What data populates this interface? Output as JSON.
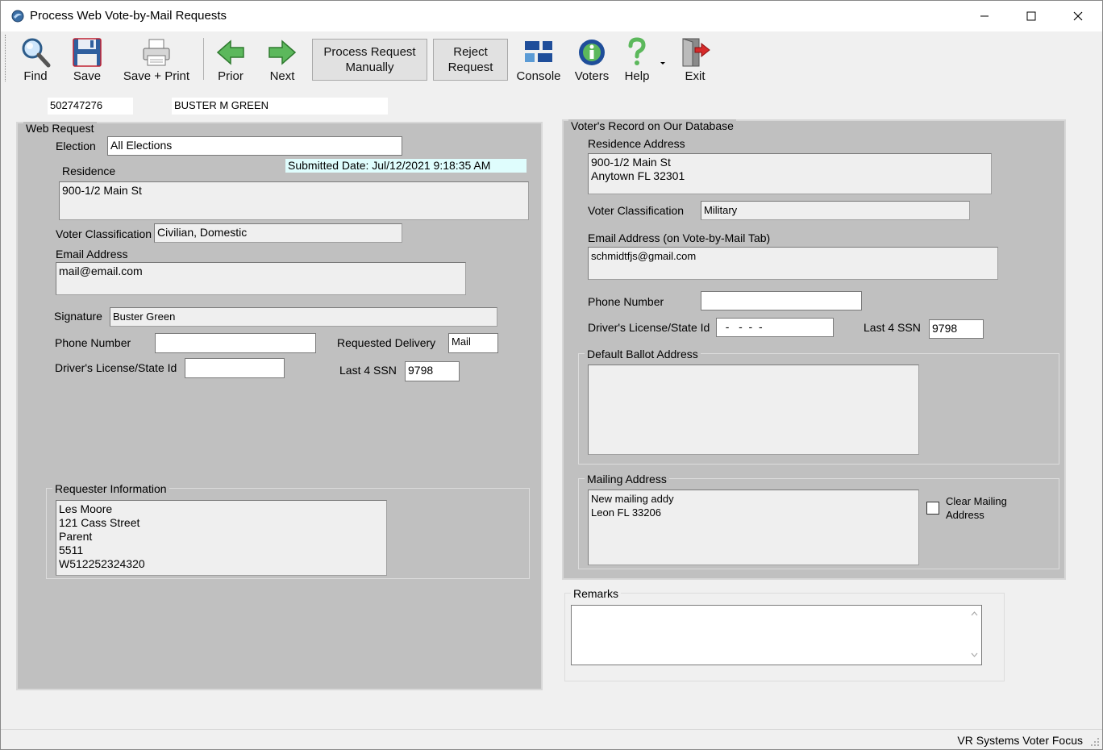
{
  "window": {
    "title": "Process Web Vote-by-Mail Requests"
  },
  "toolbar": {
    "find": "Find",
    "save": "Save",
    "save_print": "Save + Print",
    "prior": "Prior",
    "next": "Next",
    "process_manually_1": "Process Request",
    "process_manually_2": "Manually",
    "reject_1": "Reject",
    "reject_2": "Request",
    "console": "Console",
    "voters": "Voters",
    "help": "Help",
    "exit": "Exit"
  },
  "header": {
    "voter_id": "502747276",
    "voter_name": "BUSTER M GREEN"
  },
  "web_request": {
    "legend": "Web Request",
    "election_label": "Election",
    "election_value": "All Elections",
    "submitted_date": "Submitted Date: Jul/12/2021 9:18:35 AM",
    "residence_label": "Residence",
    "residence_value": "900-1/2 Main St",
    "voter_class_label": "Voter Classification",
    "voter_class_value": "Civilian, Domestic",
    "email_label": "Email Address",
    "email_value": "mail@email.com",
    "signature_label": "Signature",
    "signature_value": "Buster Green",
    "phone_label": "Phone Number",
    "phone_value": "",
    "requested_delivery_label": "Requested Delivery",
    "requested_delivery_value": "Mail",
    "dl_label": "Driver's License/State Id",
    "dl_value": "",
    "ssn_label": "Last 4 SSN",
    "ssn_value": "9798",
    "requester_legend": "Requester Information",
    "requester_lines": [
      "Les Moore",
      "121 Cass Street",
      "Parent",
      "5511",
      "W512252324320"
    ]
  },
  "voter_record": {
    "legend": "Voter's Record on Our Database",
    "residence_label": "Residence Address",
    "residence_lines": [
      "900-1/2 Main St",
      "Anytown FL 32301"
    ],
    "voter_class_label": "Voter Classification",
    "voter_class_value": "Military",
    "email_label": "Email Address (on Vote-by-Mail Tab)",
    "email_value": "schmidtfjs@gmail.com",
    "phone_label": "Phone Number",
    "phone_value": "",
    "dl_label": "Driver's License/State Id",
    "dl_value": "  -   -  -  -",
    "ssn_label": "Last 4 SSN",
    "ssn_value": "9798",
    "default_ballot_legend": "Default Ballot Address",
    "mailing_legend": "Mailing Address",
    "mailing_lines": [
      "New mailing addy",
      "Leon FL 33206"
    ],
    "clear_mailing_1": "Clear Mailing",
    "clear_mailing_2": "Address"
  },
  "remarks": {
    "legend": "Remarks",
    "value": ""
  },
  "status": {
    "text": "VR Systems Voter Focus"
  }
}
